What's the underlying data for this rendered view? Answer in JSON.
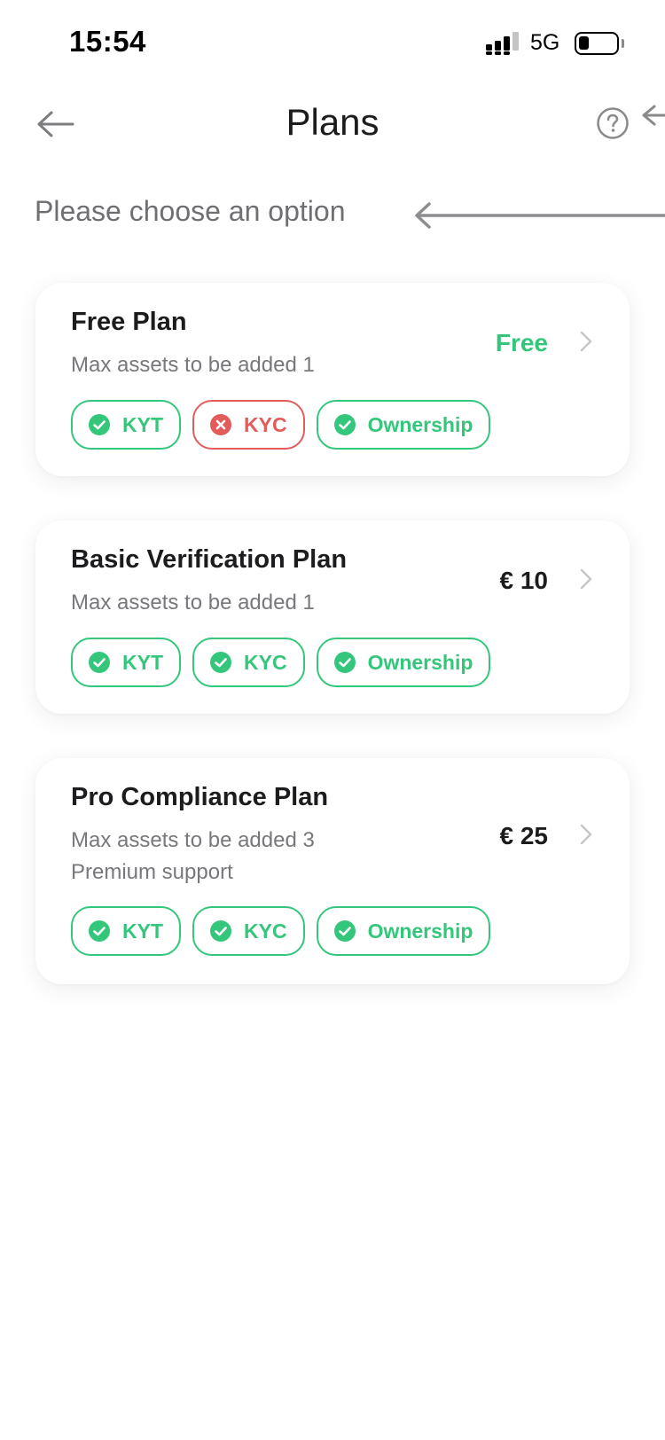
{
  "status_bar": {
    "time": "15:54",
    "network": "5G"
  },
  "header": {
    "title": "Plans",
    "back_icon": "arrow-left-icon",
    "help_icon": "question-circle-icon"
  },
  "subtitle": "Please choose an option",
  "colors": {
    "success": "#34c77b",
    "error": "#e25c5c",
    "text": "#1c1c1e",
    "muted": "#77777c"
  },
  "plans": [
    {
      "name": "Free Plan",
      "desc_line1": "Max assets to be added 1",
      "desc_line2": "",
      "price": "Free",
      "badges": [
        {
          "label": "KYT",
          "status": "ok"
        },
        {
          "label": "KYC",
          "status": "fail"
        },
        {
          "label": "Ownership",
          "status": "ok"
        }
      ]
    },
    {
      "name": "Basic Verification Plan",
      "desc_line1": "Max assets to be added 1",
      "desc_line2": "",
      "price": "€ 10",
      "badges": [
        {
          "label": "KYT",
          "status": "ok"
        },
        {
          "label": "KYC",
          "status": "ok"
        },
        {
          "label": "Ownership",
          "status": "ok"
        }
      ]
    },
    {
      "name": "Pro Compliance Plan",
      "desc_line1": "Max assets to be added 3",
      "desc_line2": "Premium support",
      "price": "€ 25",
      "badges": [
        {
          "label": "KYT",
          "status": "ok"
        },
        {
          "label": "KYC",
          "status": "ok"
        },
        {
          "label": "Ownership",
          "status": "ok"
        }
      ]
    }
  ]
}
